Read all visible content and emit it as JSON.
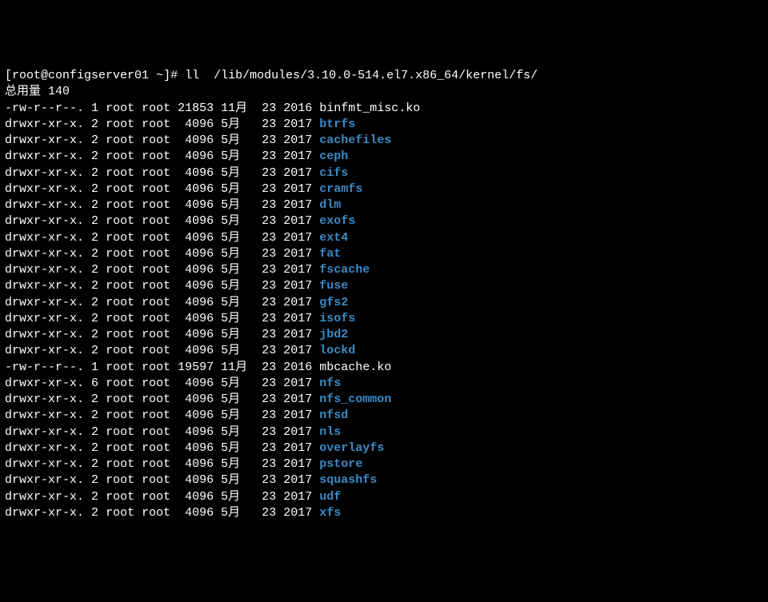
{
  "prompt": {
    "open": "[",
    "user_host": "root@configserver01",
    "sep": " ",
    "cwd": "~",
    "close": "]# ",
    "command": "ll  /lib/modules/3.10.0-514.el7.x86_64/kernel/fs/"
  },
  "total_line": "总用量 140",
  "rows": [
    {
      "perm": "-rw-r--r--.",
      "links": "1",
      "owner": "root",
      "group": "root",
      "size": "21853",
      "month": "11月",
      "day": "23",
      "year": "2016",
      "name": "binfmt_misc.ko",
      "type": "file"
    },
    {
      "perm": "drwxr-xr-x.",
      "links": "2",
      "owner": "root",
      "group": "root",
      "size": "4096",
      "month": "5月",
      "day": "23",
      "year": "2017",
      "name": "btrfs",
      "type": "dir"
    },
    {
      "perm": "drwxr-xr-x.",
      "links": "2",
      "owner": "root",
      "group": "root",
      "size": "4096",
      "month": "5月",
      "day": "23",
      "year": "2017",
      "name": "cachefiles",
      "type": "dir"
    },
    {
      "perm": "drwxr-xr-x.",
      "links": "2",
      "owner": "root",
      "group": "root",
      "size": "4096",
      "month": "5月",
      "day": "23",
      "year": "2017",
      "name": "ceph",
      "type": "dir"
    },
    {
      "perm": "drwxr-xr-x.",
      "links": "2",
      "owner": "root",
      "group": "root",
      "size": "4096",
      "month": "5月",
      "day": "23",
      "year": "2017",
      "name": "cifs",
      "type": "dir"
    },
    {
      "perm": "drwxr-xr-x.",
      "links": "2",
      "owner": "root",
      "group": "root",
      "size": "4096",
      "month": "5月",
      "day": "23",
      "year": "2017",
      "name": "cramfs",
      "type": "dir"
    },
    {
      "perm": "drwxr-xr-x.",
      "links": "2",
      "owner": "root",
      "group": "root",
      "size": "4096",
      "month": "5月",
      "day": "23",
      "year": "2017",
      "name": "dlm",
      "type": "dir"
    },
    {
      "perm": "drwxr-xr-x.",
      "links": "2",
      "owner": "root",
      "group": "root",
      "size": "4096",
      "month": "5月",
      "day": "23",
      "year": "2017",
      "name": "exofs",
      "type": "dir"
    },
    {
      "perm": "drwxr-xr-x.",
      "links": "2",
      "owner": "root",
      "group": "root",
      "size": "4096",
      "month": "5月",
      "day": "23",
      "year": "2017",
      "name": "ext4",
      "type": "dir"
    },
    {
      "perm": "drwxr-xr-x.",
      "links": "2",
      "owner": "root",
      "group": "root",
      "size": "4096",
      "month": "5月",
      "day": "23",
      "year": "2017",
      "name": "fat",
      "type": "dir"
    },
    {
      "perm": "drwxr-xr-x.",
      "links": "2",
      "owner": "root",
      "group": "root",
      "size": "4096",
      "month": "5月",
      "day": "23",
      "year": "2017",
      "name": "fscache",
      "type": "dir"
    },
    {
      "perm": "drwxr-xr-x.",
      "links": "2",
      "owner": "root",
      "group": "root",
      "size": "4096",
      "month": "5月",
      "day": "23",
      "year": "2017",
      "name": "fuse",
      "type": "dir"
    },
    {
      "perm": "drwxr-xr-x.",
      "links": "2",
      "owner": "root",
      "group": "root",
      "size": "4096",
      "month": "5月",
      "day": "23",
      "year": "2017",
      "name": "gfs2",
      "type": "dir"
    },
    {
      "perm": "drwxr-xr-x.",
      "links": "2",
      "owner": "root",
      "group": "root",
      "size": "4096",
      "month": "5月",
      "day": "23",
      "year": "2017",
      "name": "isofs",
      "type": "dir"
    },
    {
      "perm": "drwxr-xr-x.",
      "links": "2",
      "owner": "root",
      "group": "root",
      "size": "4096",
      "month": "5月",
      "day": "23",
      "year": "2017",
      "name": "jbd2",
      "type": "dir"
    },
    {
      "perm": "drwxr-xr-x.",
      "links": "2",
      "owner": "root",
      "group": "root",
      "size": "4096",
      "month": "5月",
      "day": "23",
      "year": "2017",
      "name": "lockd",
      "type": "dir"
    },
    {
      "perm": "-rw-r--r--.",
      "links": "1",
      "owner": "root",
      "group": "root",
      "size": "19597",
      "month": "11月",
      "day": "23",
      "year": "2016",
      "name": "mbcache.ko",
      "type": "file"
    },
    {
      "perm": "drwxr-xr-x.",
      "links": "6",
      "owner": "root",
      "group": "root",
      "size": "4096",
      "month": "5月",
      "day": "23",
      "year": "2017",
      "name": "nfs",
      "type": "dir"
    },
    {
      "perm": "drwxr-xr-x.",
      "links": "2",
      "owner": "root",
      "group": "root",
      "size": "4096",
      "month": "5月",
      "day": "23",
      "year": "2017",
      "name": "nfs_common",
      "type": "dir"
    },
    {
      "perm": "drwxr-xr-x.",
      "links": "2",
      "owner": "root",
      "group": "root",
      "size": "4096",
      "month": "5月",
      "day": "23",
      "year": "2017",
      "name": "nfsd",
      "type": "dir"
    },
    {
      "perm": "drwxr-xr-x.",
      "links": "2",
      "owner": "root",
      "group": "root",
      "size": "4096",
      "month": "5月",
      "day": "23",
      "year": "2017",
      "name": "nls",
      "type": "dir"
    },
    {
      "perm": "drwxr-xr-x.",
      "links": "2",
      "owner": "root",
      "group": "root",
      "size": "4096",
      "month": "5月",
      "day": "23",
      "year": "2017",
      "name": "overlayfs",
      "type": "dir"
    },
    {
      "perm": "drwxr-xr-x.",
      "links": "2",
      "owner": "root",
      "group": "root",
      "size": "4096",
      "month": "5月",
      "day": "23",
      "year": "2017",
      "name": "pstore",
      "type": "dir"
    },
    {
      "perm": "drwxr-xr-x.",
      "links": "2",
      "owner": "root",
      "group": "root",
      "size": "4096",
      "month": "5月",
      "day": "23",
      "year": "2017",
      "name": "squashfs",
      "type": "dir"
    },
    {
      "perm": "drwxr-xr-x.",
      "links": "2",
      "owner": "root",
      "group": "root",
      "size": "4096",
      "month": "5月",
      "day": "23",
      "year": "2017",
      "name": "udf",
      "type": "dir"
    },
    {
      "perm": "drwxr-xr-x.",
      "links": "2",
      "owner": "root",
      "group": "root",
      "size": "4096",
      "month": "5月",
      "day": "23",
      "year": "2017",
      "name": "xfs",
      "type": "dir"
    }
  ]
}
